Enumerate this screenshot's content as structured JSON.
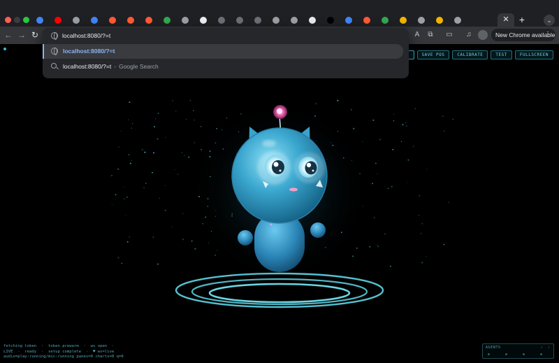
{
  "browser": {
    "omnibox_value": "localhost:8080/?=t",
    "suggestions": [
      {
        "text": "localhost:8080/?=t"
      },
      {
        "text": "localhost:8080/?=t",
        "separator": "-",
        "engine": "Google Search"
      }
    ],
    "new_tab_glyph": "+",
    "active_tab_close": "✕",
    "chrome_available": "New Chrome available",
    "menu_dots": "⋮"
  },
  "app": {
    "controls": [
      "BG",
      "SAVE POS",
      "CALIBRATE",
      "TEST",
      "FULLSCREEN"
    ],
    "log_lines": [
      "fetching token  ·  token prewarm  ·  ws open  ·",
      "LIVE  ·  ready  ·  setup complete  ·  ♥ ws=live",
      "audio=play:running/mic:running panes=0 charts=0 q=0"
    ],
    "agents_title": "AGENTS",
    "accent_color": "#46d3e6"
  }
}
